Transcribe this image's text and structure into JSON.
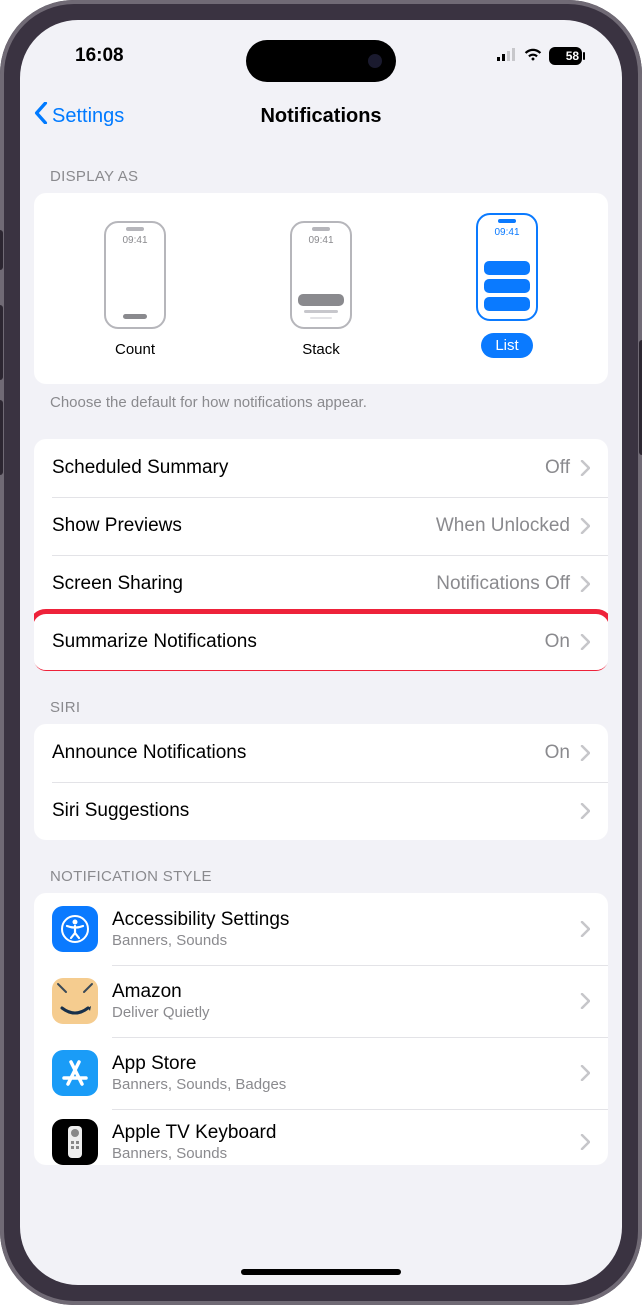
{
  "status": {
    "time": "16:08",
    "battery_text": "58"
  },
  "nav": {
    "back_label": "Settings",
    "title": "Notifications"
  },
  "display_as": {
    "header": "DISPLAY AS",
    "sample_time": "09:41",
    "options": {
      "count": "Count",
      "stack": "Stack",
      "list": "List"
    },
    "caption": "Choose the default for how notifications appear."
  },
  "settings_rows": {
    "scheduled_summary": {
      "label": "Scheduled Summary",
      "value": "Off"
    },
    "show_previews": {
      "label": "Show Previews",
      "value": "When Unlocked"
    },
    "screen_sharing": {
      "label": "Screen Sharing",
      "value": "Notifications Off"
    },
    "summarize": {
      "label": "Summarize Notifications",
      "value": "On"
    }
  },
  "siri": {
    "header": "SIRI",
    "announce": {
      "label": "Announce Notifications",
      "value": "On"
    },
    "suggestions": {
      "label": "Siri Suggestions"
    }
  },
  "style": {
    "header": "NOTIFICATION STYLE",
    "apps": [
      {
        "name": "Accessibility Settings",
        "sub": "Banners, Sounds",
        "icon": "accessibility"
      },
      {
        "name": "Amazon",
        "sub": "Deliver Quietly",
        "icon": "amazon"
      },
      {
        "name": "App Store",
        "sub": "Banners, Sounds, Badges",
        "icon": "appstore"
      },
      {
        "name": "Apple TV Keyboard",
        "sub": "Banners, Sounds",
        "icon": "apple-tv"
      }
    ]
  }
}
